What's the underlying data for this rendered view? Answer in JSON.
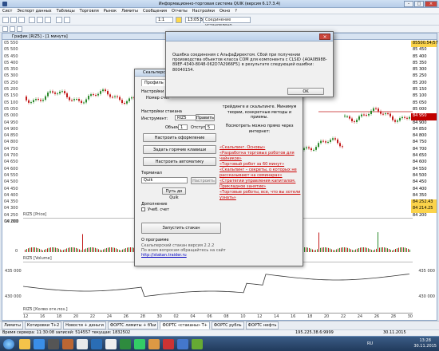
{
  "app": {
    "title": "Информационно-торговая система QUIK (версия 6.17.3.4)",
    "menu": [
      "Сист",
      "Экспорт данных",
      "Таблицы",
      "Торговля",
      "Рынок",
      "Лимиты",
      "Сообщения",
      "Отчеты",
      "Настройки",
      "Окно",
      "?"
    ],
    "toolbar_field": "1:1",
    "connection_time": "13:05:58",
    "connection_status": "Соединение установлено",
    "toolbar_m": "M5"
  },
  "chart": {
    "window_title": "График [RIZ5] - [1 минута]",
    "price_ticks": [
      "05 550",
      "05 500",
      "05 450",
      "05 400",
      "05 350",
      "05 300",
      "05 250",
      "05 200",
      "05 150",
      "05 100",
      "05 050",
      "05 000",
      "04 950",
      "04 900",
      "04 850",
      "04 800",
      "04 750",
      "04 700",
      "04 650",
      "04 600",
      "04 550",
      "04 500",
      "04 450",
      "04 400",
      "04 350",
      "04 300",
      "04 250",
      "04 200"
    ],
    "right_labels": [
      "85500.54/57",
      "85 450",
      "85 400",
      "85 350",
      "85 300",
      "85 250",
      "85 200",
      "85 150",
      "85 100",
      "85 050",
      "85 000",
      "84 950",
      "84 900",
      "84 850",
      "84 800",
      "84 750",
      "84 700",
      "84 650",
      "84 600",
      "84 550",
      "84 500",
      "84 450",
      "84 400",
      "84 350",
      "84 252.43",
      "84 214.25",
      "84 200"
    ],
    "pane_price_label": "RIZ5 [Price]",
    "pane_volume_label": "RIZ5 [Volume]",
    "pane_oi_label": "RIZ5 [Колво отк.поз.]",
    "vol_ticks": [
      "10 000",
      "0"
    ],
    "oi_ticks": [
      "435 000",
      "430 000"
    ],
    "oi_right": [
      "435 000",
      "430 000"
    ],
    "dates": [
      "12",
      "16",
      "18",
      "20",
      "22",
      "24",
      "26",
      "28",
      "30",
      "02",
      "04",
      "06",
      "08",
      "10",
      "12",
      "14",
      "16",
      "18",
      "20",
      "22",
      "24",
      "26",
      "28",
      "30"
    ]
  },
  "scalper": {
    "title": "Скальперский стакан",
    "tab_profile": "Профиль",
    "settings_label": "Настройки сче",
    "account_label": "Номер счет",
    "stakan_settings": "Настройки стакана",
    "instrument_label": "Инструмент:",
    "instrument_value": "RIZ5",
    "edit_button": "Править",
    "volume_label": "Объем:",
    "volume_value": "1",
    "offset_label": "Отступ:",
    "offset_value": "5",
    "design_button": "Настроить оформление",
    "hotkeys_button": "Задать горячие клавиши",
    "automation_button": "Настроить автоматику",
    "terminal_label": "Терминал",
    "terminal_value": "Quik",
    "terminal_settings_button": "Настроить",
    "quik_path_button": "Путь до Quik",
    "extra_label": "Дополнение",
    "account_check_label": "Учеб. счет",
    "start_button": "Запустить стакан",
    "about_label": "О программе",
    "about_lines": [
      "Скальперский стакан версия 2.2.2",
      "По всем вопросам обращайтесь на сайт",
      "http://stakan.traider.ru"
    ],
    "promo_text": "трейдинге и скальпинге. Минимум теории, конкретные методы и приемы.",
    "video_text": "Посмотреть можно прямо через интернет:",
    "links": [
      "«Скальпинг. Основы»",
      "«Разработка торговых роботов для чайников»",
      "«Торговый робот за 60 минут»",
      "«Скальпинг – секреты, о которых не рассказывают на семинарах»",
      "«Стратегии управления капиталом. Прикладное занятие»",
      "«Торговые роботы, все, что вы хотели узнать»"
    ]
  },
  "message_box": {
    "text": "Ошибка соединения с АльфаДиректом. Сбой при получении производства объектов класса COM для компонента с CLSID {A0A0B988-89EF-4340-8048-062D7A2966F5} в результате следующей ошибки: 80040154.",
    "ok_button": "OK"
  },
  "tabs": [
    "Лимиты",
    "Котировки T+2",
    "Новости + деньги",
    "ФОРТС лимиты + бЪи",
    "ФОРТС «стаканы» T+",
    "ФОРТС рубль",
    "ФОРТС нефть"
  ],
  "status": {
    "left": "Время сервера: 11:30:08  записей: 514557  текущая: 1832502",
    "ip": "195.225.38.6:9999",
    "date": "30.11.2015"
  },
  "taskbar": {
    "lang": "RU",
    "time": "13:28",
    "date": "30.11.2015"
  },
  "colors": {
    "bull": "#2c8a2c",
    "bear": "#c21a1a",
    "error_red": "#c00000",
    "taskbar": "#213a5c",
    "accent": "#c9453b"
  }
}
